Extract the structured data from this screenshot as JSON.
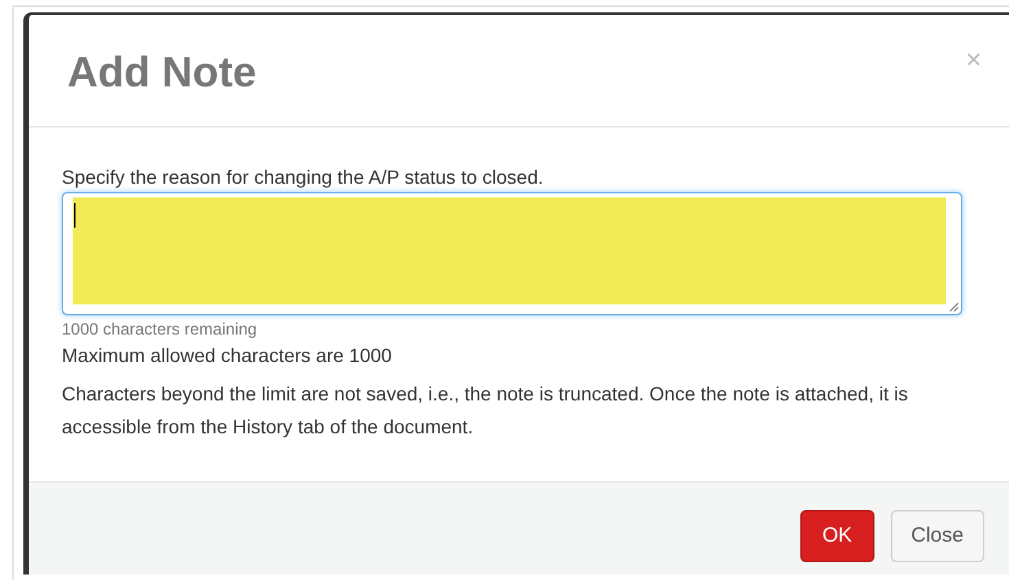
{
  "dialog": {
    "title": "Add Note",
    "close_icon": "×"
  },
  "prompt": "Specify the reason for changing the A/P status to closed.",
  "note_field": {
    "highlighted": true
  },
  "remaining": "1000 characters remaining",
  "maximum": "Maximum allowed characters are 1000",
  "info": "Characters beyond the limit are not saved, i.e., the note is truncated. Once the note is attached, it is accessible from the History tab of the document.",
  "buttons": [
    {
      "label": "OK",
      "kind": "primary"
    },
    {
      "label": "Close",
      "kind": "default"
    }
  ]
}
